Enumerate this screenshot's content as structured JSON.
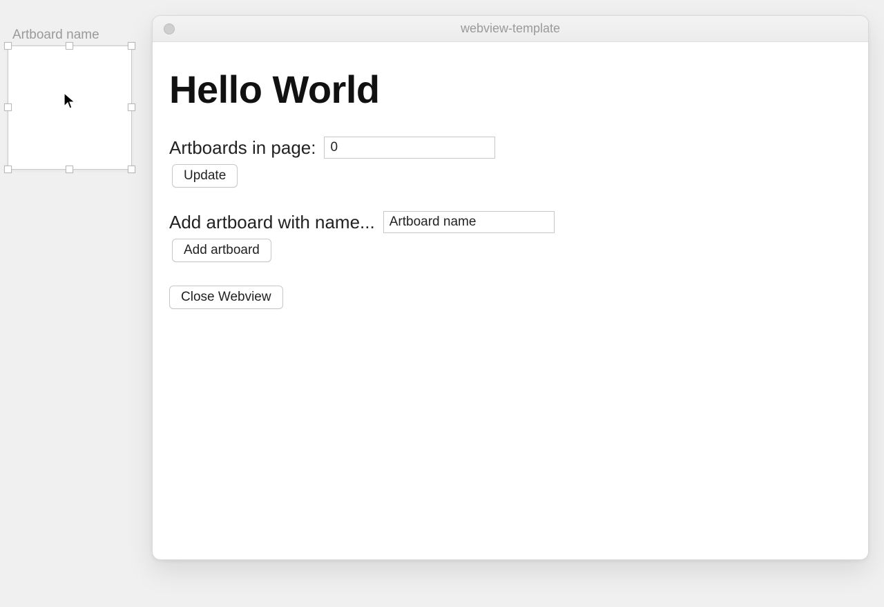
{
  "canvas": {
    "artboard_label": "Artboard name"
  },
  "window": {
    "title": "webview-template",
    "heading": "Hello World",
    "artboards_label": "Artboards in page:",
    "artboards_count": "0",
    "update_label": "Update",
    "add_prompt": "Add artboard with name...",
    "name_input_value": "Artboard name",
    "add_label": "Add artboard",
    "close_label": "Close Webview"
  }
}
